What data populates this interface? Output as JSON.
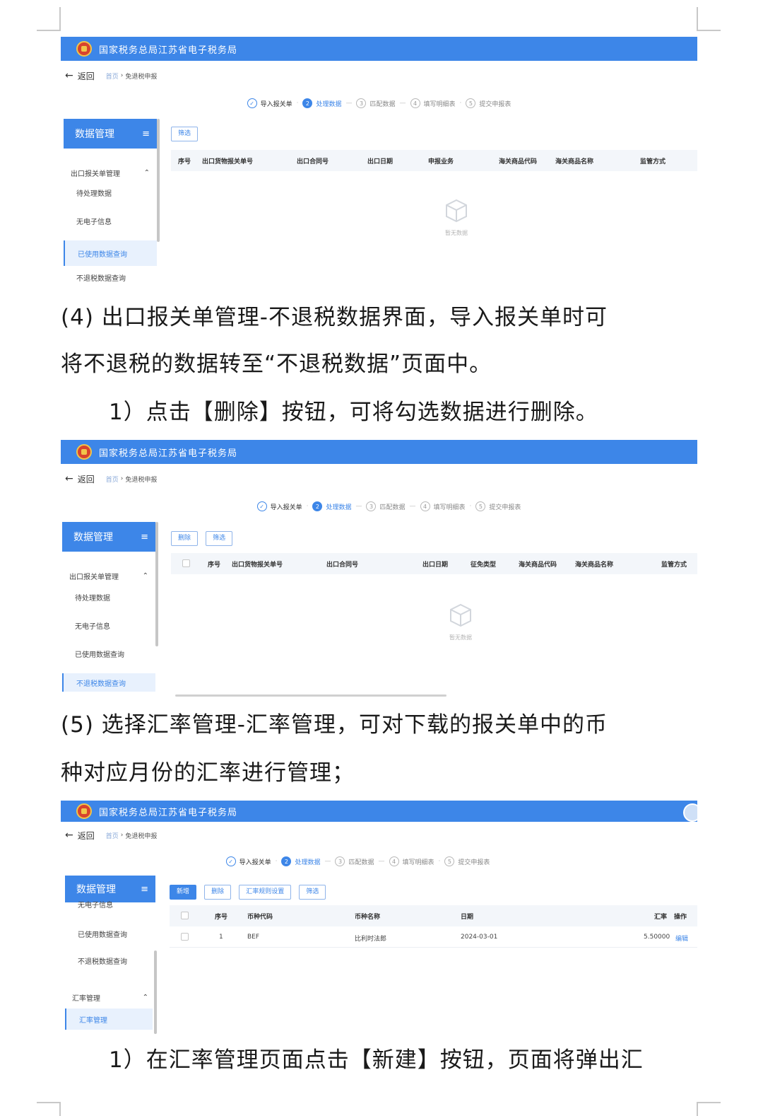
{
  "header_title": "国家税务总局江苏省电子税务局",
  "back_label": "返回",
  "crumb_home": "首页",
  "crumb_sep": "›",
  "crumb_current": "免退税申报",
  "steps": [
    {
      "num": "✓",
      "label": "导入报关单"
    },
    {
      "num": "2",
      "label": "处理数据"
    },
    {
      "num": "3",
      "label": "匹配数据"
    },
    {
      "num": "4",
      "label": "填写明细表"
    },
    {
      "num": "5",
      "label": "提交申报表"
    }
  ],
  "step_seps": [
    "·",
    "—",
    "—",
    "·"
  ],
  "sidebar_title": "数据管理",
  "menu_icon": "≡",
  "empty_label": "暂无数据",
  "shot1": {
    "group": "出口报关单管理",
    "items": [
      "待处理数据",
      "无电子信息",
      "已使用数据查询",
      "不退税数据查询"
    ],
    "filter_label": "筛选",
    "columns": [
      "序号",
      "出口货物报关单号",
      "出口合同号",
      "出口日期",
      "申报业务",
      "海关商品代码",
      "海关商品名称",
      "监管方式"
    ]
  },
  "shot2": {
    "group": "出口报关单管理",
    "items": [
      "待处理数据",
      "无电子信息",
      "已使用数据查询",
      "不退税数据查询"
    ],
    "delete_label": "删除",
    "filter_label": "筛选",
    "columns": [
      "序号",
      "出口货物报关单号",
      "出口合同号",
      "出口日期",
      "征免类型",
      "海关商品代码",
      "海关商品名称",
      "监管方式"
    ]
  },
  "shot3": {
    "items_top": [
      "无电子信息",
      "已使用数据查询",
      "不退税数据查询"
    ],
    "group": "汇率管理",
    "items_bottom": [
      "汇率管理"
    ],
    "new_label": "新增",
    "delete_label": "删除",
    "setting_label": "汇率规则设置",
    "filter_label": "筛选",
    "columns": [
      "序号",
      "币种代码",
      "币种名称",
      "日期",
      "汇率",
      "操作"
    ],
    "row": {
      "index": "1",
      "code": "BEF",
      "name": "比利时法郎",
      "date": "2024-03-01",
      "rate": "5.50000",
      "action": "编辑"
    }
  },
  "paragraphs": {
    "p4_line1": "(4) 出口报关单管理-不退税数据界面，导入报关单时可",
    "p4_line2": "将不退税的数据转至“不退税数据”页面中。",
    "p4_step": "1）点击【删除】按钮，可将勾选数据进行删除。",
    "p5_line1": "(5) 选择汇率管理-汇率管理，可对下载的报关单中的币",
    "p5_line2": "种对应月份的汇率进行管理；",
    "p5_step": "1）在汇率管理页面点击【新建】按钮，页面将弹出汇"
  }
}
